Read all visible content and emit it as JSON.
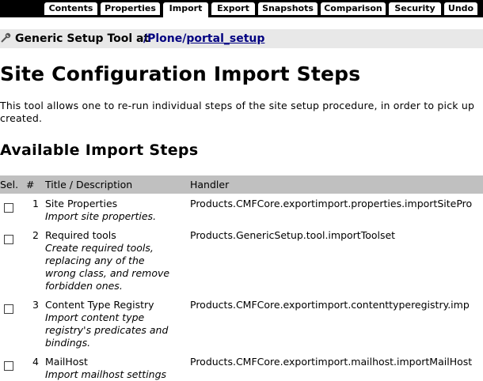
{
  "tabs": [
    {
      "label": "Contents"
    },
    {
      "label": "Properties"
    },
    {
      "label": "Import"
    },
    {
      "label": "Export"
    },
    {
      "label": "Snapshots"
    },
    {
      "label": "Comparison"
    },
    {
      "label": "Security"
    },
    {
      "label": "Undo"
    }
  ],
  "active_tab": "Import",
  "location": {
    "label": "Generic Setup Tool at",
    "path_root": "/Plone",
    "separator": "/",
    "path_leaf": "portal_setup"
  },
  "page_title": "Site Configuration Import Steps",
  "intro": "This tool allows one to re-run individual steps of the site setup procedure, in order to pick up created.",
  "section_title": "Available Import Steps",
  "table": {
    "headers": {
      "sel": "Sel.",
      "num": "#",
      "title": "Title / Description",
      "handler": "Handler"
    },
    "rows": [
      {
        "num": "1",
        "title": "Site Properties",
        "description": "Import site properties.",
        "handler": "Products.CMFCore.exportimport.properties.importSitePro"
      },
      {
        "num": "2",
        "title": "Required tools",
        "description": "Create required tools,\nreplacing any of the\nwrong class, and remove\nforbidden ones.",
        "handler": "Products.GenericSetup.tool.importToolset"
      },
      {
        "num": "3",
        "title": "Content Type Registry",
        "description": "Import content type\nregistry's predicates and\nbindings.",
        "handler": "Products.CMFCore.exportimport.contenttyperegistry.imp"
      },
      {
        "num": "4",
        "title": "MailHost",
        "description": "Import mailhost settings",
        "handler": "Products.CMFCore.exportimport.mailhost.importMailHost"
      }
    ]
  }
}
